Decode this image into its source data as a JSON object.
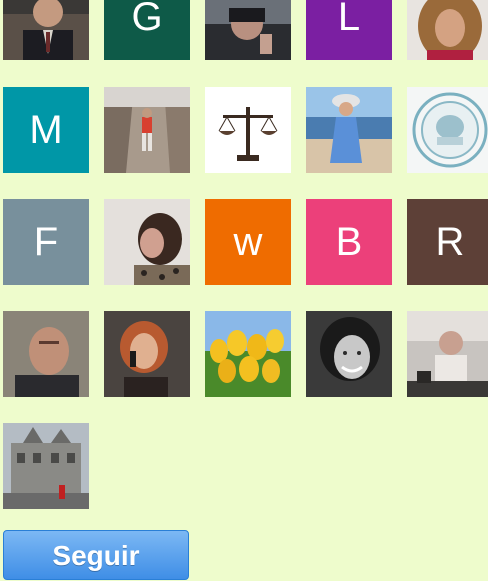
{
  "followers": {
    "row1": [
      {
        "name": "avatar-photo-man-suit",
        "kind": "photo"
      },
      {
        "name": "avatar-letter-g",
        "kind": "letter",
        "letter": "G",
        "color": "#0e5a48"
      },
      {
        "name": "avatar-photo-person-dark",
        "kind": "photo"
      },
      {
        "name": "avatar-letter-l",
        "kind": "letter",
        "letter": "L",
        "color": "#7b1fa2"
      },
      {
        "name": "avatar-photo-woman-curly",
        "kind": "photo"
      }
    ],
    "row2": [
      {
        "name": "avatar-letter-m",
        "kind": "letter",
        "letter": "M",
        "color": "#0097a7"
      },
      {
        "name": "avatar-photo-person-rocks",
        "kind": "photo"
      },
      {
        "name": "avatar-photo-scales",
        "kind": "photo"
      },
      {
        "name": "avatar-photo-girl-beach",
        "kind": "photo"
      },
      {
        "name": "avatar-photo-emblem",
        "kind": "photo"
      }
    ],
    "row3": [
      {
        "name": "avatar-letter-f",
        "kind": "letter",
        "letter": "F",
        "color": "#78909c"
      },
      {
        "name": "avatar-photo-woman-profile",
        "kind": "photo"
      },
      {
        "name": "avatar-letter-w",
        "kind": "letter",
        "letter": "w",
        "color": "#ef6c00"
      },
      {
        "name": "avatar-letter-b",
        "kind": "letter",
        "letter": "B",
        "color": "#ec407a"
      },
      {
        "name": "avatar-letter-r",
        "kind": "letter",
        "letter": "R",
        "color": "#5d4037"
      }
    ],
    "row4": [
      {
        "name": "avatar-photo-man-bald",
        "kind": "photo"
      },
      {
        "name": "avatar-photo-woman-phone",
        "kind": "photo"
      },
      {
        "name": "avatar-photo-tulips",
        "kind": "photo"
      },
      {
        "name": "avatar-photo-woman-smile-bw",
        "kind": "photo"
      },
      {
        "name": "avatar-photo-man-cafe",
        "kind": "photo"
      }
    ],
    "row5": [
      {
        "name": "avatar-photo-building",
        "kind": "photo"
      }
    ]
  },
  "follow_button": {
    "label": "Seguir",
    "color": "#3f8ee6"
  }
}
